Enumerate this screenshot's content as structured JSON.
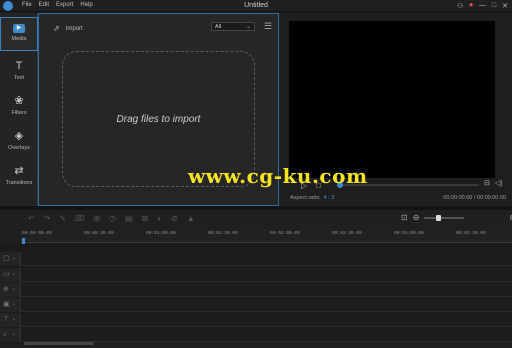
{
  "app": {
    "title": "Untitled"
  },
  "menu": [
    "File",
    "Edit",
    "Export",
    "Help"
  ],
  "window_controls": {
    "icons": [
      "user-icon",
      "rec-icon",
      "minimize-icon",
      "maximize-icon",
      "close-icon"
    ],
    "symbols": [
      "⚇",
      "⏺",
      "—",
      "□",
      "✕"
    ]
  },
  "sidebar": {
    "items": [
      {
        "label": "Media",
        "icon": "▶",
        "active": true
      },
      {
        "label": "Text",
        "icon": "T"
      },
      {
        "label": "Filters",
        "icon": "❀"
      },
      {
        "label": "Overlays",
        "icon": "◈"
      },
      {
        "label": "Transitions",
        "icon": "⇄"
      }
    ]
  },
  "media": {
    "import_label": "Import",
    "import_icon": "⇗",
    "filter_value": "All",
    "list_icon": "☰",
    "drop_text": "Drag files to import"
  },
  "player": {
    "controls": [
      "▷",
      "□"
    ],
    "right_icons": [
      "⊟",
      "◁)"
    ],
    "aspect_label": "Aspect ratio:",
    "aspect_value": "4 : 3",
    "timecode": "00:00:00.00 / 00:00:00.00",
    "progress": 0
  },
  "watermark": "www.cg-ku.com",
  "toolbar": {
    "tools": [
      "↶",
      "↷",
      "✎",
      "⌧",
      "⊞",
      "◷",
      "▤",
      "⊠",
      "◐",
      "⊘",
      "▲"
    ],
    "zoom_out": "⊖",
    "zoom_in": "⊕",
    "fit": "⊡",
    "zoom_level": 0.3
  },
  "ruler": {
    "ticks": [
      "00:00:00.00",
      "00:00:30.00",
      "00:01:00.00",
      "00:01:30.00",
      "00:02:00.00",
      "00:02:30.00",
      "00:03:00.00",
      "00:03:30.00"
    ]
  },
  "tracks": {
    "icons": [
      "▢",
      "▭",
      "⊕",
      "▣",
      "⊤",
      "♪"
    ],
    "lock": "🔒"
  },
  "colors": {
    "accent": "#3e89d0",
    "watermark": "#f2e41f",
    "panel_border": "#2f6ba6"
  }
}
